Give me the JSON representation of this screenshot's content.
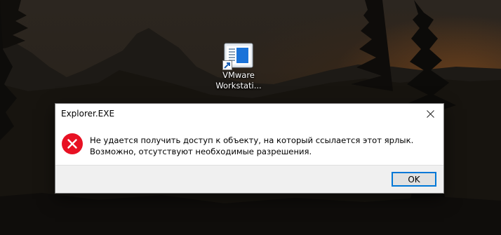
{
  "desktop": {
    "shortcut": {
      "label_line1": "VMware",
      "label_line2": "Workstati..."
    }
  },
  "dialog": {
    "title": "Explorer.EXE",
    "message": "Не удается получить доступ к объекту, на который ссылается этот ярлык. Возможно, отсутствуют необходимые разрешения.",
    "ok_label": "OK"
  },
  "colors": {
    "error_red": "#e81123",
    "focus_blue": "#0078d7",
    "footer_gray": "#f0f0f0"
  }
}
